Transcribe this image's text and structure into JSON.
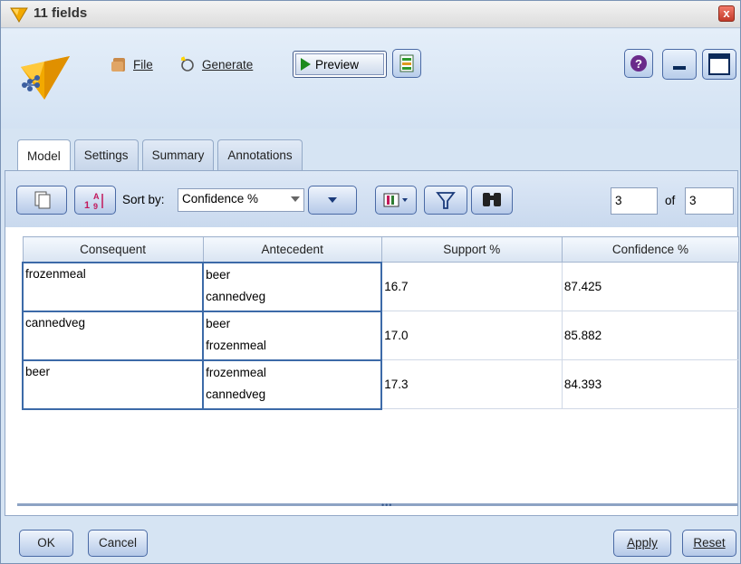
{
  "window": {
    "title": "11 fields",
    "close_label": "x"
  },
  "toolbar": {
    "file_label": "File",
    "generate_label": "Generate",
    "preview_label": "Preview"
  },
  "tabs": [
    {
      "label": "Model",
      "active": true
    },
    {
      "label": "Settings",
      "active": false
    },
    {
      "label": "Summary",
      "active": false
    },
    {
      "label": "Annotations",
      "active": false
    }
  ],
  "subtoolbar": {
    "sort_by_label": "Sort by:",
    "sort_by_value": "Confidence %",
    "page_current": "3",
    "page_of_label": "of",
    "page_total": "3"
  },
  "table": {
    "columns": [
      "Consequent",
      "Antecedent",
      "Support %",
      "Confidence %"
    ],
    "rows": [
      {
        "consequent": "frozenmeal",
        "antecedent": [
          "beer",
          "cannedveg"
        ],
        "support": "16.7",
        "confidence": "87.425"
      },
      {
        "consequent": "cannedveg",
        "antecedent": [
          "beer",
          "frozenmeal"
        ],
        "support": "17.0",
        "confidence": "85.882"
      },
      {
        "consequent": "beer",
        "antecedent": [
          "frozenmeal",
          "cannedveg"
        ],
        "support": "17.3",
        "confidence": "84.393"
      }
    ]
  },
  "buttons": {
    "ok": "OK",
    "cancel": "Cancel",
    "apply": "Apply",
    "reset": "Reset"
  },
  "colors": {
    "accent": "#3c6aa8",
    "panel_bg": "#d6e4f3",
    "preview_play": "#1d8a1d",
    "title_icon": "#f2a900"
  },
  "icons": [
    "model-node-icon",
    "file-icon",
    "generate-icon",
    "preview-play-icon",
    "grid-icon",
    "help-icon",
    "minimize-icon",
    "maximize-icon",
    "copy-icon",
    "sort-az-icon",
    "sort-dropdown-icon",
    "column-chooser-icon",
    "filter-icon",
    "find-icon"
  ]
}
